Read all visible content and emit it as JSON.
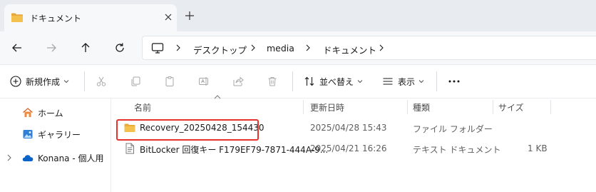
{
  "tab": {
    "title": "ドキュメント"
  },
  "breadcrumb": {
    "items": [
      "デスクトップ",
      "media",
      "ドキュメント"
    ]
  },
  "commands": {
    "new_label": "新規作成",
    "sort_label": "並べ替え",
    "view_label": "表示"
  },
  "sidebar": {
    "items": [
      {
        "label": "ホーム"
      },
      {
        "label": "ギャラリー"
      },
      {
        "label": "Konana - 個人用"
      }
    ]
  },
  "columns": {
    "name": "名前",
    "modified": "更新日時",
    "type": "種類",
    "size": "サイズ"
  },
  "files": [
    {
      "name": "Recovery_20250428_154430",
      "modified": "2025/04/28 15:43",
      "type": "ファイル フォルダー",
      "size": "",
      "icon": "folder-icon"
    },
    {
      "name": "BitLocker 回復キー F179EF79-7871-444A-9...",
      "modified": "2025/04/21 16:26",
      "type": "テキスト ドキュメント",
      "size": "1 KB",
      "icon": "text-file-icon"
    }
  ],
  "colors": {
    "folder": "#f4c14f",
    "highlight": "#e8322d",
    "accent": "#0067c0"
  }
}
